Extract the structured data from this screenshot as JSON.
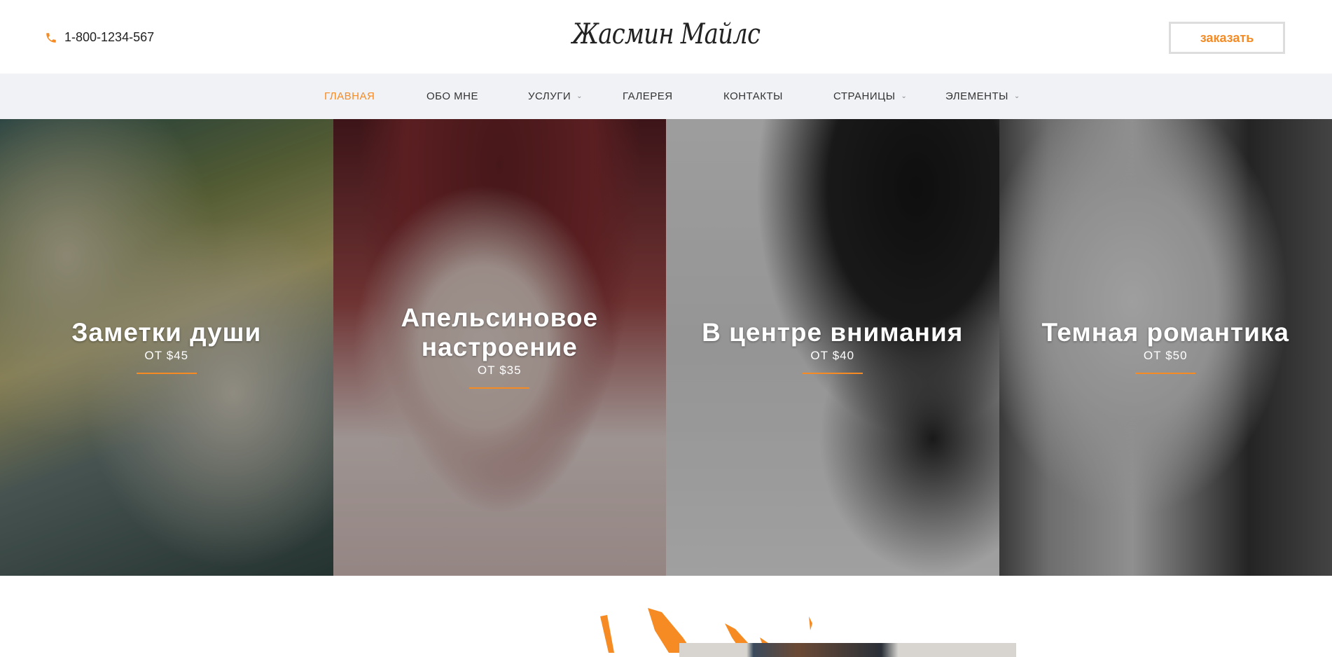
{
  "header": {
    "phone": "1-800-1234-567",
    "logo": "Жасмин Майлс",
    "order_button": "заказать"
  },
  "nav": {
    "items": [
      {
        "label": "ГЛАВНАЯ",
        "active": true
      },
      {
        "label": "ОБО МНЕ"
      },
      {
        "label": "УСЛУГИ",
        "dropdown": true
      },
      {
        "label": "ГАЛЕРЕЯ"
      },
      {
        "label": "КОНТАКТЫ"
      },
      {
        "label": "СТРАНИЦЫ",
        "dropdown": true
      },
      {
        "label": "ЭЛЕМЕНТЫ",
        "dropdown": true
      }
    ]
  },
  "panels": [
    {
      "title": "Заметки души",
      "price": "ОТ $45"
    },
    {
      "title": "Апельсиновое настроение",
      "price": "ОТ $35"
    },
    {
      "title": "В центре внимания",
      "price": "ОТ $40"
    },
    {
      "title": "Темная романтика",
      "price": "ОТ $50"
    }
  ],
  "colors": {
    "accent": "#f68b23",
    "nav_bg": "#f1f2f6"
  }
}
